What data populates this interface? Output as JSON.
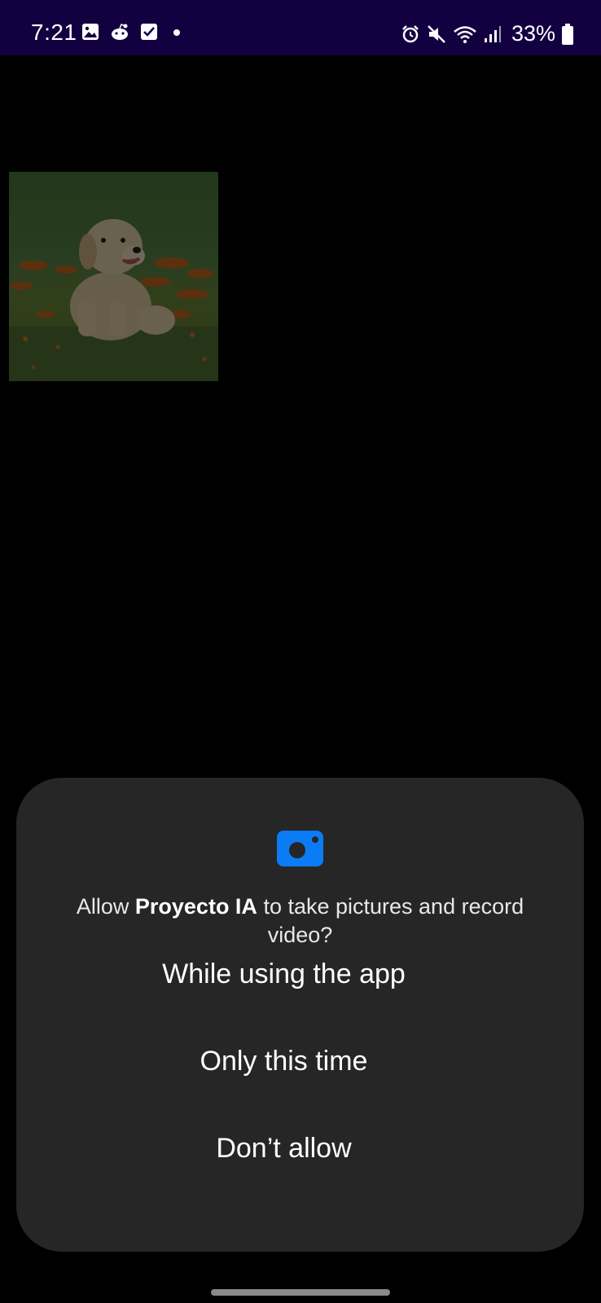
{
  "status_bar": {
    "time": "7:21",
    "battery_percent": "33%",
    "left_icons": [
      "gallery-icon",
      "reddit-icon",
      "checkbox-icon",
      "dot-icon"
    ],
    "right_icons": [
      "alarm-icon",
      "mute-icon",
      "wifi-icon",
      "signal-icon",
      "battery-icon"
    ],
    "background_color": "#130041"
  },
  "image": {
    "subject": "puppy-photo"
  },
  "dialog": {
    "icon": "camera-icon",
    "icon_color": "#0b7cf5",
    "message_prefix": "Allow ",
    "app_name": "Proyecto IA",
    "message_suffix": " to take pictures and record video?",
    "options": [
      {
        "label": "While using the app"
      },
      {
        "label": "Only this time"
      },
      {
        "label": "Don’t allow"
      }
    ],
    "background_color": "#262626"
  }
}
